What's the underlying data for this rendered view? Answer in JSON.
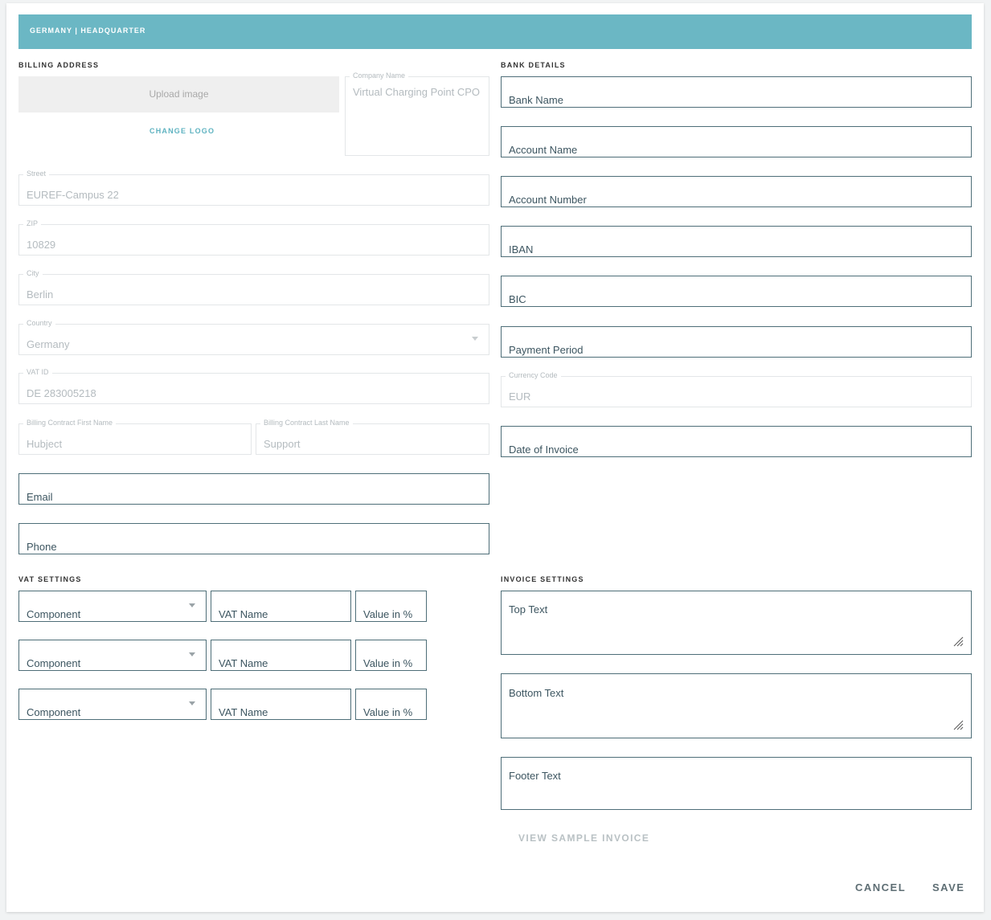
{
  "header": {
    "title": "GERMANY | HEADQUARTER"
  },
  "billing": {
    "section_title": "BILLING ADDRESS",
    "upload_label": "Upload image",
    "change_logo": "CHANGE LOGO",
    "company_name": {
      "label": "Company Name",
      "value": "Virtual Charging Point CPO"
    },
    "street": {
      "label": "Street",
      "value": "EUREF-Campus 22"
    },
    "zip": {
      "label": "ZIP",
      "value": "10829"
    },
    "city": {
      "label": "City",
      "value": "Berlin"
    },
    "country": {
      "label": "Country",
      "value": "Germany"
    },
    "vat_id": {
      "label": "VAT ID",
      "value": "DE 283005218"
    },
    "first_name": {
      "label": "Billing Contract First Name",
      "value": "Hubject"
    },
    "last_name": {
      "label": "Billing Contract Last Name",
      "value": "Support"
    },
    "email": {
      "placeholder": "Email"
    },
    "phone": {
      "placeholder": "Phone"
    }
  },
  "bank": {
    "section_title": "BANK DETAILS",
    "bank_name": "Bank Name",
    "account_name": "Account Name",
    "account_number": "Account Number",
    "iban": "IBAN",
    "bic": "BIC",
    "payment_period": "Payment Period",
    "currency_code": {
      "label": "Currency Code",
      "value": "EUR"
    },
    "date_of_invoice": "Date of Invoice"
  },
  "vat_settings": {
    "section_title": "VAT SETTINGS",
    "rows": [
      {
        "component": "Component",
        "vat_name": "VAT Name",
        "value": "Value in %"
      },
      {
        "component": "Component",
        "vat_name": "VAT Name",
        "value": "Value in %"
      },
      {
        "component": "Component",
        "vat_name": "VAT Name",
        "value": "Value in %"
      }
    ]
  },
  "invoice_settings": {
    "section_title": "INVOICE SETTINGS",
    "top_text": "Top Text",
    "bottom_text": "Bottom Text",
    "footer_text": "Footer Text",
    "view_sample": "VIEW SAMPLE INVOICE"
  },
  "actions": {
    "cancel": "CANCEL",
    "save": "SAVE"
  },
  "colors": {
    "banner": "#6bb7c4",
    "accent": "#5fb3c1",
    "field_border": "#4e6e78"
  }
}
